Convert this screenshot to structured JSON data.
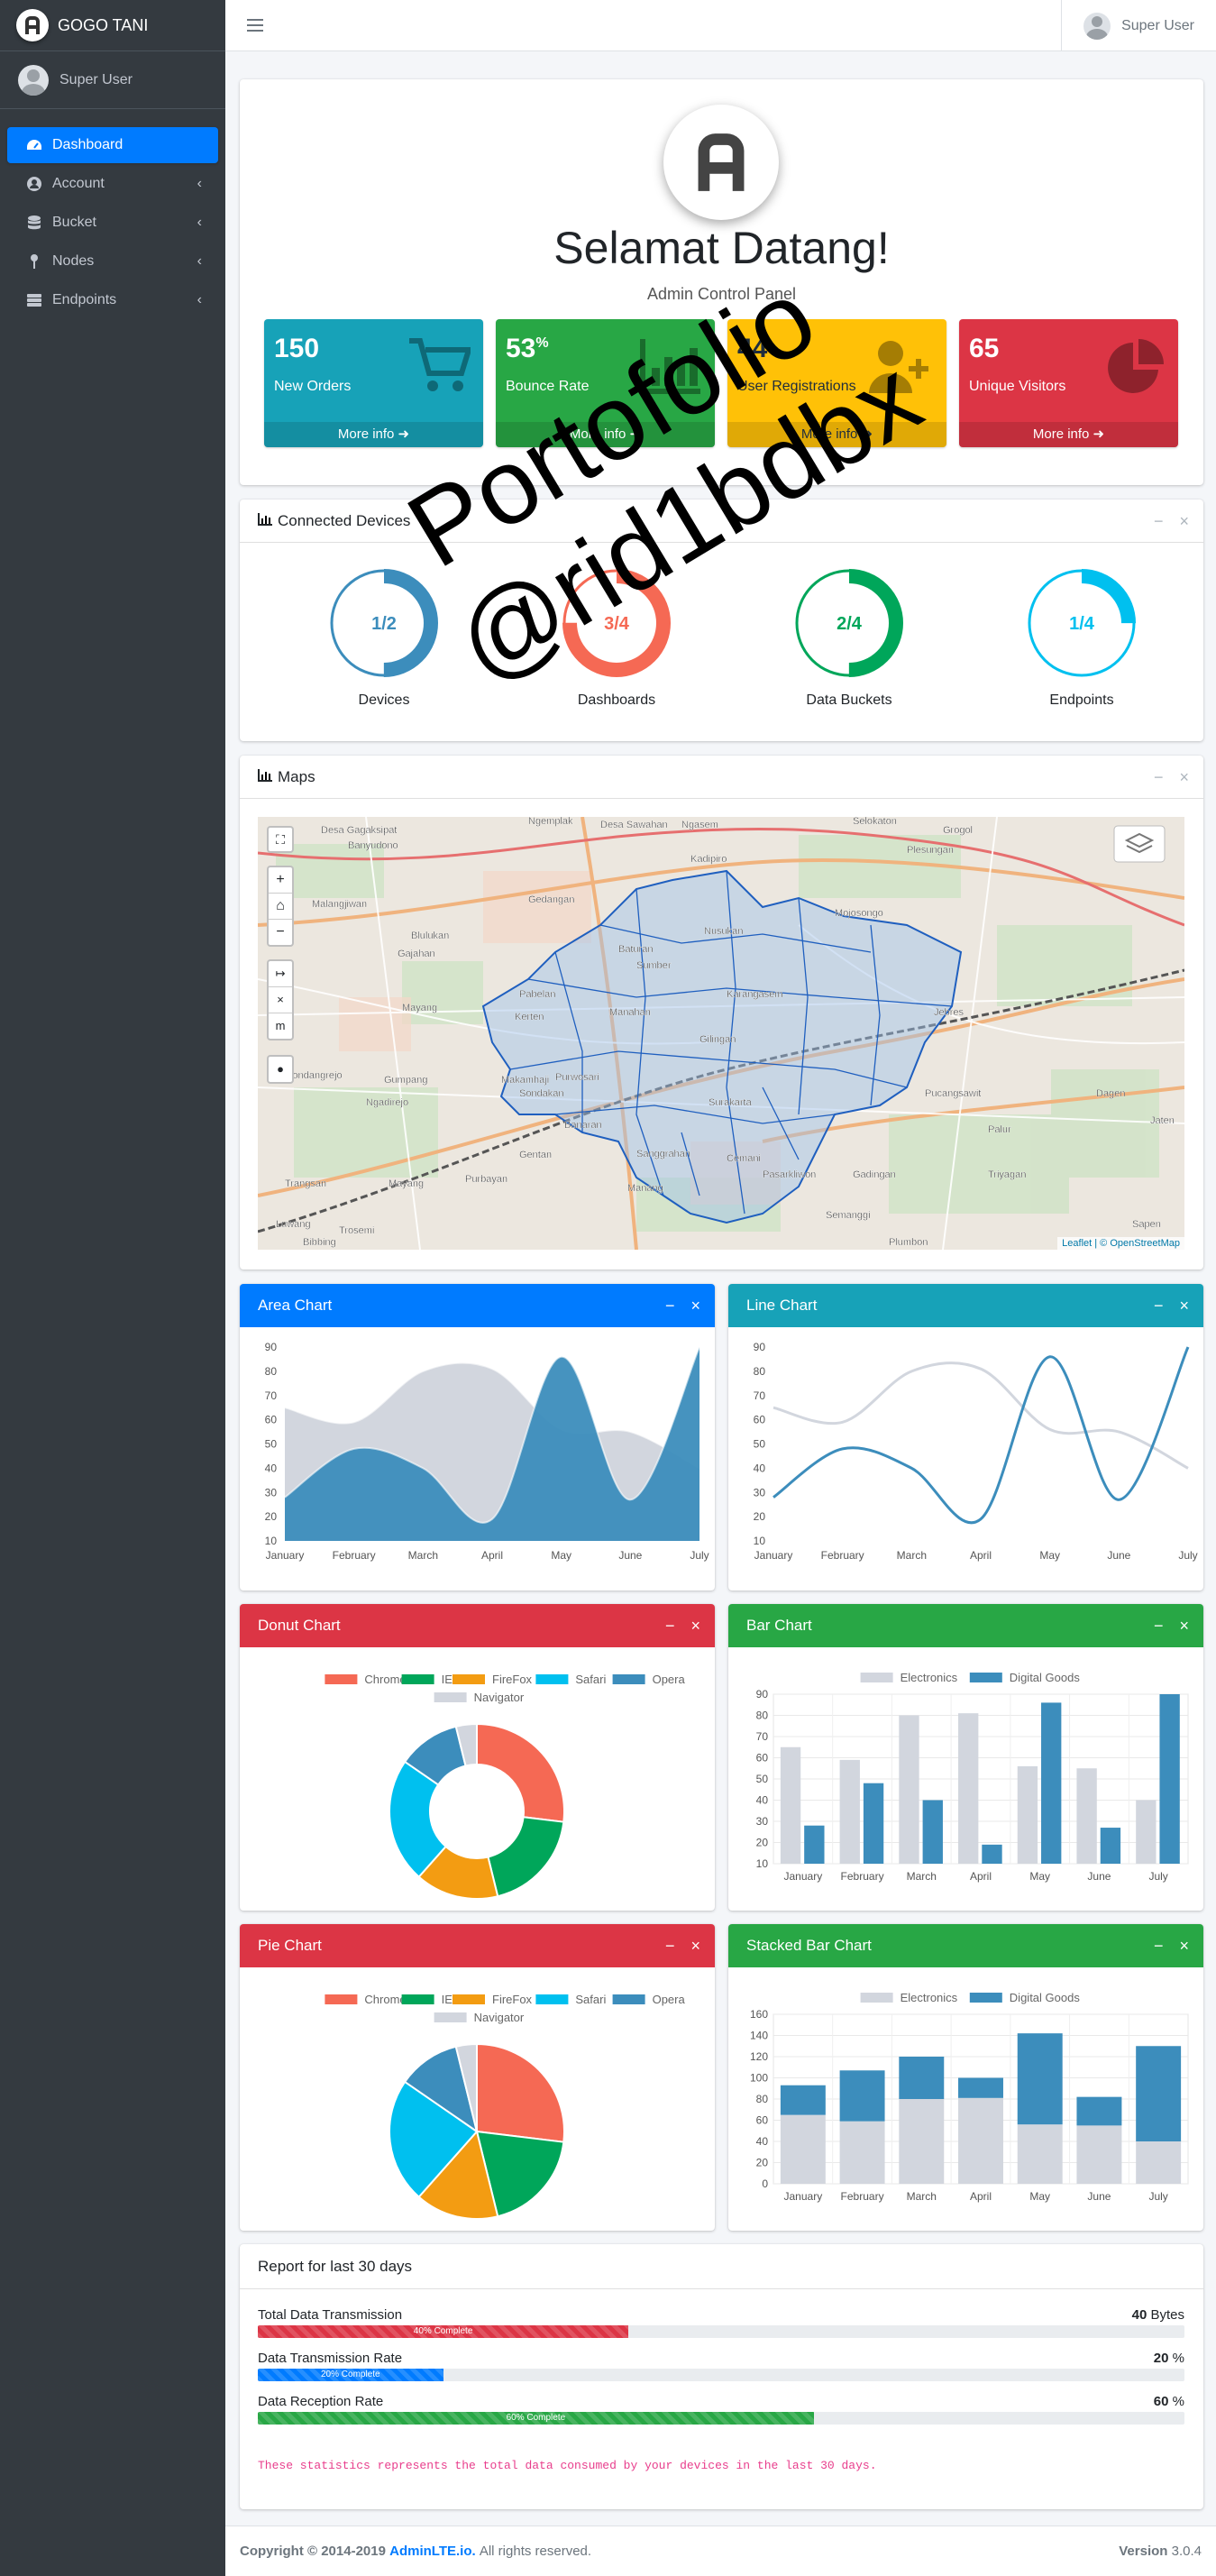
{
  "app": {
    "brand": "GOGO TANI",
    "user": "Super User"
  },
  "sidebar": {
    "items": [
      {
        "label": "Dashboard",
        "icon": "dashboard-icon",
        "active": true
      },
      {
        "label": "Account",
        "icon": "user-circle-icon"
      },
      {
        "label": "Bucket",
        "icon": "database-icon"
      },
      {
        "label": "Nodes",
        "icon": "map-pin-icon"
      },
      {
        "label": "Endpoints",
        "icon": "server-icon"
      }
    ]
  },
  "header": {
    "user": "Super User"
  },
  "welcome": {
    "title": "Selamat Datang!",
    "subtitle": "Admin Control Panel",
    "boxes": [
      {
        "value": "150",
        "suffix": "",
        "label": "New Orders",
        "more": "More info",
        "color": "#17a2b8",
        "icon": "shopping-cart-icon"
      },
      {
        "value": "53",
        "suffix": "%",
        "label": "Bounce Rate",
        "more": "More info",
        "color": "#28a745",
        "icon": "bar-chart-icon"
      },
      {
        "value": "44",
        "suffix": "",
        "label": "User Registrations",
        "more": "More info",
        "color": "#ffc107",
        "icon": "user-plus-icon"
      },
      {
        "value": "65",
        "suffix": "",
        "label": "Unique Visitors",
        "more": "More info",
        "color": "#dc3545",
        "icon": "pie-chart-icon"
      }
    ]
  },
  "devices": {
    "title": "Connected Devices",
    "knobs": [
      {
        "label": "Devices",
        "text": "1/2",
        "fraction": 0.5,
        "color": "#3c8dbc"
      },
      {
        "label": "Dashboards",
        "text": "3/4",
        "fraction": 0.75,
        "color": "#f56954"
      },
      {
        "label": "Data Buckets",
        "text": "2/4",
        "fraction": 0.5,
        "color": "#00a65a"
      },
      {
        "label": "Endpoints",
        "text": "1/4",
        "fraction": 0.25,
        "color": "#00c0ef"
      }
    ]
  },
  "maps": {
    "title": "Maps",
    "attribution": "Leaflet | © OpenStreetMap",
    "zoom_in": "+",
    "zoom_out": "−",
    "measure_unit": "m",
    "places": [
      "Desa Gagaksipat",
      "Banyudono",
      "Ngemplak",
      "Desa Sawahan",
      "Gedangan",
      "Kadipiro",
      "Plesungan",
      "Malangjiwan",
      "Blulukan",
      "Gajahan",
      "Baturan",
      "Sumber",
      "Nusukan",
      "Mojosongo",
      "Karangasem",
      "Gilingan",
      "Jebres",
      "Pabelan",
      "Kerten",
      "Manahan",
      "Purwosari",
      "Sondakan",
      "Makamhaji",
      "Gumpang",
      "Surakarta",
      "Pucangsawit",
      "Ngadirejo",
      "Dagen",
      "Gentan",
      "Banaran",
      "Pasarkliwon",
      "Gadingan",
      "Palur",
      "Trangsan",
      "Mayang",
      "Purbayan",
      "Triyagan",
      "Cemani",
      "Sanggrahan",
      "Manang",
      "Semanggi",
      "Luwang",
      "Bibbing",
      "Trosemi",
      "Plumbon",
      "Sapen",
      "Jaten",
      "Gondangrejo",
      "Ngasem",
      "Selokaton",
      "Grogol",
      "Mayang"
    ]
  },
  "charts": {
    "area_title": "Area Chart",
    "line_title": "Line Chart",
    "donut_title": "Donut Chart",
    "bar_title": "Bar Chart",
    "pie_title": "Pie Chart",
    "stacked_title": "Stacked Bar Chart"
  },
  "chart_data": [
    {
      "type": "area",
      "title": "Area Chart",
      "categories": [
        "January",
        "February",
        "March",
        "April",
        "May",
        "June",
        "July"
      ],
      "ylim": [
        10,
        90
      ],
      "yticks": [
        10,
        20,
        30,
        40,
        50,
        60,
        70,
        80,
        90
      ],
      "series": [
        {
          "values": [
            65,
            59,
            80,
            81,
            56,
            55,
            40
          ],
          "color": "#d2d6de"
        },
        {
          "values": [
            28,
            48,
            40,
            19,
            86,
            27,
            90
          ],
          "color": "#3c8dbc"
        }
      ]
    },
    {
      "type": "line",
      "title": "Line Chart",
      "categories": [
        "January",
        "February",
        "March",
        "April",
        "May",
        "June",
        "July"
      ],
      "ylim": [
        10,
        90
      ],
      "yticks": [
        10,
        20,
        30,
        40,
        50,
        60,
        70,
        80,
        90
      ],
      "series": [
        {
          "values": [
            65,
            59,
            80,
            81,
            56,
            55,
            40
          ],
          "color": "#d2d6de"
        },
        {
          "values": [
            28,
            48,
            40,
            19,
            86,
            27,
            90
          ],
          "color": "#3c8dbc"
        }
      ]
    },
    {
      "type": "pie",
      "title": "Donut Chart",
      "donut": true,
      "labels": [
        "Chrome",
        "IE",
        "FireFox",
        "Safari",
        "Opera",
        "Navigator"
      ],
      "values": [
        700,
        500,
        400,
        600,
        300,
        100
      ],
      "colors": [
        "#f56954",
        "#00a65a",
        "#f39c12",
        "#00c0ef",
        "#3c8dbc",
        "#d2d6de"
      ]
    },
    {
      "type": "bar",
      "title": "Bar Chart",
      "categories": [
        "January",
        "February",
        "March",
        "April",
        "May",
        "June",
        "July"
      ],
      "ylim": [
        10,
        90
      ],
      "yticks": [
        10,
        20,
        30,
        40,
        50,
        60,
        70,
        80,
        90
      ],
      "series": [
        {
          "name": "Electronics",
          "values": [
            65,
            59,
            80,
            81,
            56,
            55,
            40
          ],
          "color": "#d2d6de"
        },
        {
          "name": "Digital Goods",
          "values": [
            28,
            48,
            40,
            19,
            86,
            27,
            90
          ],
          "color": "#3c8dbc"
        }
      ]
    },
    {
      "type": "pie",
      "title": "Pie Chart",
      "donut": false,
      "labels": [
        "Chrome",
        "IE",
        "FireFox",
        "Safari",
        "Opera",
        "Navigator"
      ],
      "values": [
        700,
        500,
        400,
        600,
        300,
        100
      ],
      "colors": [
        "#f56954",
        "#00a65a",
        "#f39c12",
        "#00c0ef",
        "#3c8dbc",
        "#d2d6de"
      ]
    },
    {
      "type": "bar",
      "stacked": true,
      "title": "Stacked Bar Chart",
      "categories": [
        "January",
        "February",
        "March",
        "April",
        "May",
        "June",
        "July"
      ],
      "ylim": [
        0,
        160
      ],
      "yticks": [
        0,
        20,
        40,
        60,
        80,
        100,
        120,
        140,
        160
      ],
      "series": [
        {
          "name": "Electronics",
          "values": [
            65,
            59,
            80,
            81,
            56,
            55,
            40
          ],
          "color": "#d2d6de"
        },
        {
          "name": "Digital Goods",
          "values": [
            28,
            48,
            40,
            19,
            86,
            27,
            90
          ],
          "color": "#3c8dbc"
        }
      ]
    }
  ],
  "report": {
    "title": "Report for last 30 days",
    "rows": [
      {
        "label": "Total Data Transmission",
        "value": "40",
        "unit": "Bytes",
        "percent": 40,
        "bar_text": "40% Complete",
        "color": "#dc3545"
      },
      {
        "label": "Data Transmission Rate",
        "value": "20",
        "unit": "%",
        "percent": 20,
        "bar_text": "20% Complete",
        "color": "#007bff"
      },
      {
        "label": "Data Reception Rate",
        "value": "60",
        "unit": "%",
        "percent": 60,
        "bar_text": "60% Complete",
        "color": "#28a745"
      }
    ],
    "note": "These statistics represents the total data consumed by your devices in the last 30 days."
  },
  "footer": {
    "copyright": "Copyright © 2014-2019",
    "link": "AdminLTE.io.",
    "rights": "All rights reserved.",
    "version_label": "Version",
    "version": "3.0.4"
  },
  "watermark": {
    "line1": "Portofolio",
    "line2": "@rid1bdbx"
  }
}
